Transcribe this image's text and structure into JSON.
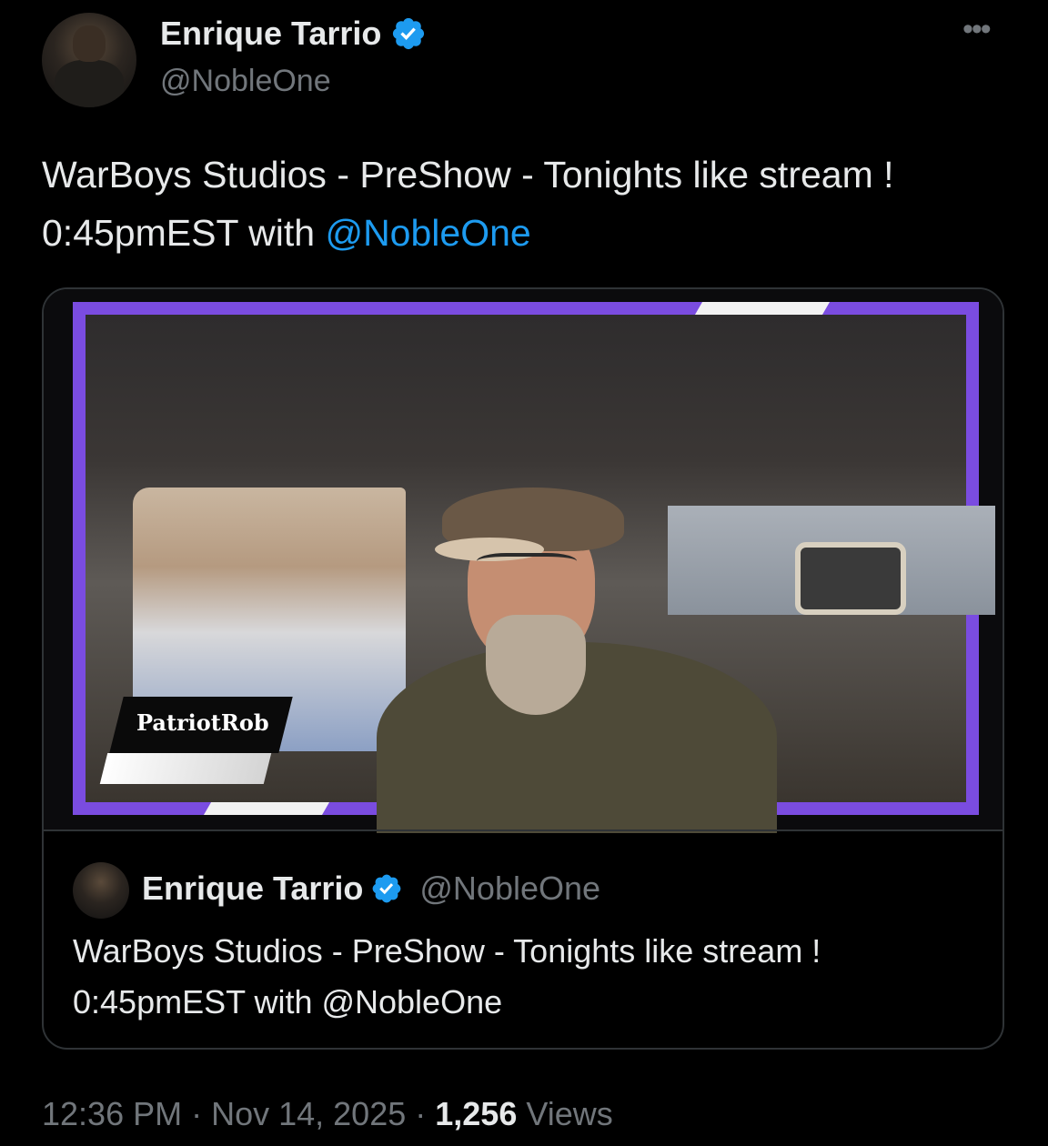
{
  "author": {
    "name": "Enrique Tarrio",
    "handle": "@NobleOne",
    "verified_icon": "verified-badge-icon"
  },
  "more_icon": "more-options-icon",
  "tweet": {
    "text_line1": "WarBoys Studios - PreShow - Tonights like stream !",
    "text_line2_prefix": "0:45pmEST with ",
    "mention": "@NobleOne"
  },
  "media": {
    "lower_third_label": "PatriotRob"
  },
  "quoted": {
    "name": "Enrique Tarrio",
    "handle": "@NobleOne",
    "text_line1": "WarBoys Studios - PreShow - Tonights like stream !",
    "text_line2": "0:45pmEST with @NobleOne"
  },
  "meta": {
    "time": "12:36 PM",
    "separator": " · ",
    "date": "Nov 14, 2025",
    "views_count": "1,256",
    "views_label": " Views"
  },
  "colors": {
    "accent": "#1d9bf0",
    "frame": "#7a4ce0",
    "muted": "#71767b"
  }
}
